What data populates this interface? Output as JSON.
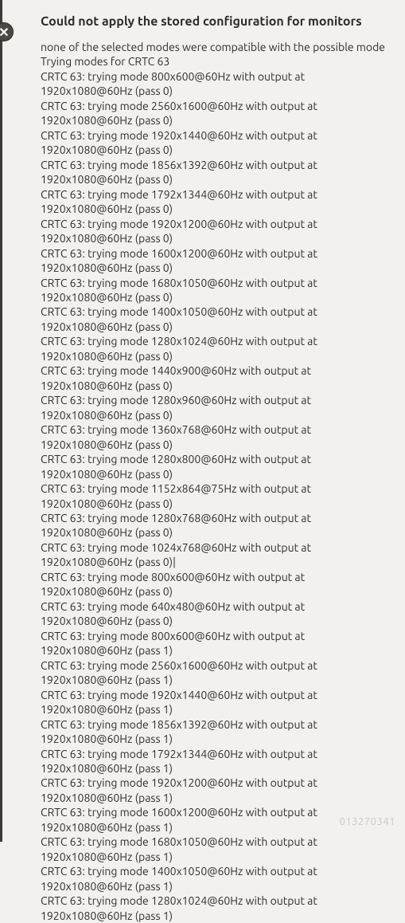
{
  "dialog": {
    "title": "Could not apply the stored configuration for monitors",
    "summary": "none of the selected modes were compatible with the possible mode",
    "header_line": "Trying modes for CRTC 63",
    "entries": [
      {
        "mode": "800x600@60Hz",
        "output": "1920x1080@60Hz",
        "pass": 0
      },
      {
        "mode": "2560x1600@60Hz",
        "output": "1920x1080@60Hz",
        "pass": 0
      },
      {
        "mode": "1920x1440@60Hz",
        "output": "1920x1080@60Hz",
        "pass": 0
      },
      {
        "mode": "1856x1392@60Hz",
        "output": "1920x1080@60Hz",
        "pass": 0
      },
      {
        "mode": "1792x1344@60Hz",
        "output": "1920x1080@60Hz",
        "pass": 0
      },
      {
        "mode": "1920x1200@60Hz",
        "output": "1920x1080@60Hz",
        "pass": 0
      },
      {
        "mode": "1600x1200@60Hz",
        "output": "1920x1080@60Hz",
        "pass": 0
      },
      {
        "mode": "1680x1050@60Hz",
        "output": "1920x1080@60Hz",
        "pass": 0
      },
      {
        "mode": "1400x1050@60Hz",
        "output": "1920x1080@60Hz",
        "pass": 0
      },
      {
        "mode": "1280x1024@60Hz",
        "output": "1920x1080@60Hz",
        "pass": 0
      },
      {
        "mode": "1440x900@60Hz",
        "output": "1920x1080@60Hz",
        "pass": 0
      },
      {
        "mode": "1280x960@60Hz",
        "output": "1920x1080@60Hz",
        "pass": 0
      },
      {
        "mode": "1360x768@60Hz",
        "output": "1920x1080@60Hz",
        "pass": 0
      },
      {
        "mode": "1280x800@60Hz",
        "output": "1920x1080@60Hz",
        "pass": 0
      },
      {
        "mode": "1152x864@75Hz",
        "output": "1920x1080@60Hz",
        "pass": 0
      },
      {
        "mode": "1280x768@60Hz",
        "output": "1920x1080@60Hz",
        "pass": 0
      },
      {
        "mode": "1024x768@60Hz",
        "output": "1920x1080@60Hz",
        "pass": 0,
        "cursor": true
      },
      {
        "mode": "800x600@60Hz",
        "output": "1920x1080@60Hz",
        "pass": 0
      },
      {
        "mode": "640x480@60Hz",
        "output": "1920x1080@60Hz",
        "pass": 0
      },
      {
        "mode": "800x600@60Hz",
        "output": "1920x1080@60Hz",
        "pass": 1
      },
      {
        "mode": "2560x1600@60Hz",
        "output": "1920x1080@60Hz",
        "pass": 1
      },
      {
        "mode": "1920x1440@60Hz",
        "output": "1920x1080@60Hz",
        "pass": 1
      },
      {
        "mode": "1856x1392@60Hz",
        "output": "1920x1080@60Hz",
        "pass": 1
      },
      {
        "mode": "1792x1344@60Hz",
        "output": "1920x1080@60Hz",
        "pass": 1
      },
      {
        "mode": "1920x1200@60Hz",
        "output": "1920x1080@60Hz",
        "pass": 1
      },
      {
        "mode": "1600x1200@60Hz",
        "output": "1920x1080@60Hz",
        "pass": 1
      },
      {
        "mode": "1680x1050@60Hz",
        "output": "1920x1080@60Hz",
        "pass": 1
      },
      {
        "mode": "1400x1050@60Hz",
        "output": "1920x1080@60Hz",
        "pass": 1
      },
      {
        "mode": "1280x1024@60Hz",
        "output": "1920x1080@60Hz",
        "pass": 1
      }
    ],
    "crtc": "CRTC 63"
  },
  "close_icon_glyph": "✕",
  "watermark": "013270341"
}
